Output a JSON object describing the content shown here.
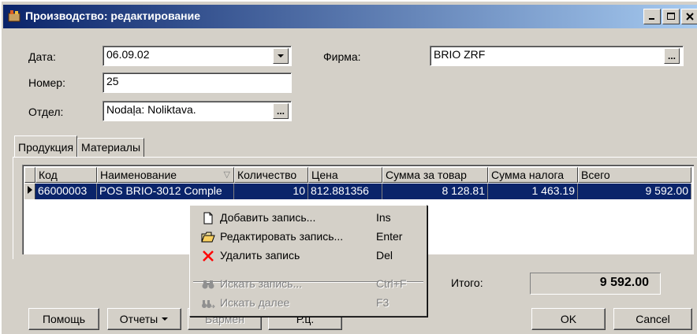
{
  "window": {
    "title": "Производство: редактирование"
  },
  "form": {
    "date_label": "Дата:",
    "date_value": "06.09.02",
    "number_label": "Номер:",
    "number_value": "25",
    "department_label": "Отдел:",
    "department_value": "Nodaļa: Noliktava.",
    "firm_label": "Фирма:",
    "firm_value": "BRIO ZRF",
    "ellipsis": "..."
  },
  "tabs": [
    {
      "label": "Продукция"
    },
    {
      "label": "Материалы"
    }
  ],
  "grid": {
    "columns": [
      "Код",
      "Наименование",
      "Количество",
      "Цена",
      "Сумма за товар",
      "Сумма налога",
      "Всего"
    ],
    "rows": [
      [
        "66000003",
        "POS BRIO-3012 Comple",
        "10",
        "812.881356",
        "8 128.81",
        "1 463.19",
        "9 592.00"
      ]
    ]
  },
  "context_menu": [
    {
      "label": "Добавить запись...",
      "key": "Ins",
      "icon": "new-document-icon",
      "enabled": true
    },
    {
      "label": "Редактировать запись...",
      "key": "Enter",
      "icon": "open-folder-icon",
      "enabled": true
    },
    {
      "label": "Удалить запись",
      "key": "Del",
      "icon": "delete-x-icon",
      "enabled": true
    },
    {
      "label": "Искать запись...",
      "key": "Ctrl+F",
      "icon": "binoculars-icon",
      "enabled": false
    },
    {
      "label": "Искать далее",
      "key": "F3",
      "icon": "find-next-icon",
      "enabled": false
    }
  ],
  "totals": {
    "label": "Итого:",
    "value": "9 592.00"
  },
  "buttons": {
    "help": "Помощь",
    "reports": "Отчеты",
    "barman": "Бармен",
    "price": "Р.ц.",
    "ok": "OK",
    "cancel": "Cancel"
  },
  "colors": {
    "selection": "#0a246a",
    "face": "#d4d0c8",
    "delete_icon": "#ff0000"
  }
}
